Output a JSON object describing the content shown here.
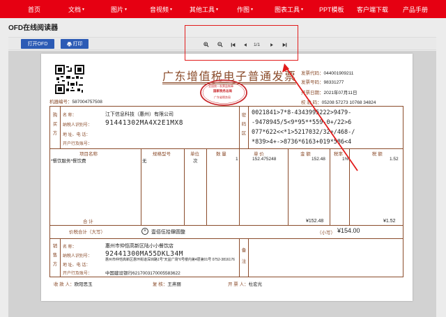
{
  "nav": {
    "items": [
      {
        "label": "首页",
        "chevron": false
      },
      {
        "label": "文档",
        "chevron": true
      },
      {
        "label": "图片",
        "chevron": true
      },
      {
        "label": "音视频",
        "chevron": true
      },
      {
        "label": "其他工具",
        "chevron": true
      },
      {
        "label": "作图",
        "chevron": true
      },
      {
        "label": "图表工具",
        "chevron": true
      },
      {
        "label": "PPT模板",
        "chevron": false
      },
      {
        "label": "客户端下载",
        "chevron": false
      },
      {
        "label": "产品手册",
        "chevron": false
      }
    ],
    "chevron_glyph": "▾",
    "bg_color": "#e60012"
  },
  "reader": {
    "title": "OFD在线阅读器"
  },
  "toolbar": {
    "open_label": "打开OFD",
    "print_label": "打印",
    "page_indicator": "1/1"
  },
  "invoice": {
    "title": "广东增值税电子普通发票",
    "seal_top": "全国统一发票监制章",
    "seal_mid": "国家税务总局",
    "seal_bottom": "广东省税务局",
    "machine_no_label": "机器编号：",
    "machine_no": "587004757508",
    "code_label": "发票代码：",
    "code": "044001909211",
    "number_label": "发票号码：",
    "number": "98331277",
    "date_label": "开票日期：",
    "date": "2021年07月11日",
    "check_label": "校 验 码：",
    "check_code": "05208 57273 10768 34824",
    "buyer_side": "购 买 方",
    "buyer_name_label": "名          称：",
    "buyer_name": "江下信息科技（惠州）有限公司",
    "buyer_tax_label": "纳税人识别号：",
    "buyer_tax": "91441302MA4X2E1MX8",
    "buyer_addr_label": "地 址、电 话：",
    "buyer_bank_label": "开户行及账号：",
    "cipher_side": "密 码 区",
    "cipher_lines": [
      "0021841>7*8-4343995222>9479-",
      "-9478945/5<9*95**559-0+/22>6",
      "077*622<<*1>5217032/32+/468-/",
      "*839>4+->8736*6163+019*586<4"
    ],
    "columns": [
      "项目名称",
      "规格型号",
      "单位",
      "数 量",
      "单 价",
      "金 额",
      "税率",
      "税 额"
    ],
    "item": {
      "name": "*餐饮服务*餐饮费",
      "spec": "无",
      "unit": "次",
      "qty": "1",
      "price": "152.475248",
      "amount": "152.48",
      "rate": "1%",
      "tax": "1.52"
    },
    "total_label": "合     计",
    "total_amount": "¥152.48",
    "total_tax": "¥1.52",
    "grand_label": "价税合计（大写）",
    "grand_upper": "壹佰伍拾肆圆整",
    "grand_small_label": "（小写）",
    "grand_small": "¥154.00",
    "seller_side": "销 售 方",
    "seller_name_label": "名          称：",
    "seller_name": "惠州市仲恺高新区陆小小餐饮店",
    "seller_tax_label": "纳税人识别号：",
    "seller_tax": "92441300MA55DKL34M",
    "seller_addr_label": "地 址、电 话：",
    "seller_addr": "惠州市仲恺高新区惠环街道深圳路1号“天益广场”6号楼内第4层第01号 0752-3816176",
    "seller_bank_label": "开户行及账号：",
    "seller_bank": "中国建设银行6217003170005583622",
    "remark_side": "备 注",
    "payee_label": "收 款 人：",
    "payee": "欧阳思玉",
    "reviewer_label": "复 核：",
    "reviewer": "王燕丽",
    "drawer_label": "开 票 人：",
    "drawer": "杜宏光"
  }
}
